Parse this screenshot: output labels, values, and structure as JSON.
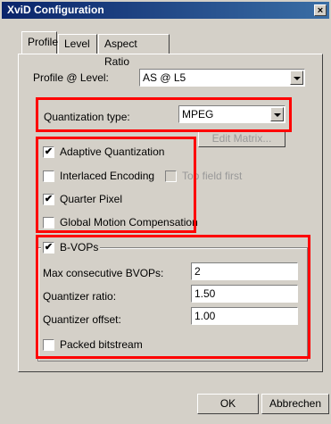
{
  "window": {
    "title": "XviD Configuration",
    "close_glyph": "×"
  },
  "tabs": [
    {
      "label": "Profile",
      "active": true
    },
    {
      "label": "Level",
      "active": false
    },
    {
      "label": "Aspect Ratio",
      "active": false
    }
  ],
  "profile": {
    "label": "Profile @ Level:",
    "value": "AS @ L5"
  },
  "quantization": {
    "label": "Quantization type:",
    "value": "MPEG",
    "edit_matrix": "Edit Matrix..."
  },
  "options": {
    "adaptive_quant": {
      "label": "Adaptive Quantization",
      "checked": true
    },
    "interlaced": {
      "label": "Interlaced Encoding",
      "checked": false
    },
    "top_field_first": {
      "label": "Top field first",
      "checked": false,
      "enabled": false
    },
    "quarter_pixel": {
      "label": "Quarter Pixel",
      "checked": true
    },
    "gmc": {
      "label": "Global Motion Compensation",
      "checked": false
    }
  },
  "bvops": {
    "label": "B-VOPs",
    "checked": true,
    "max_consecutive": {
      "label": "Max consecutive BVOPs:",
      "value": "2"
    },
    "quantizer_ratio": {
      "label": "Quantizer ratio:",
      "value": "1.50"
    },
    "quantizer_offset": {
      "label": "Quantizer offset:",
      "value": "1.00"
    },
    "packed": {
      "label": "Packed bitstream",
      "checked": false
    }
  },
  "buttons": {
    "ok": "OK",
    "cancel": "Abbrechen"
  },
  "check_glyph": "✔",
  "colors": {
    "titlebar": "#0a246a",
    "highlight_box": "#ff0000",
    "dialog": "#d4d0c8"
  }
}
